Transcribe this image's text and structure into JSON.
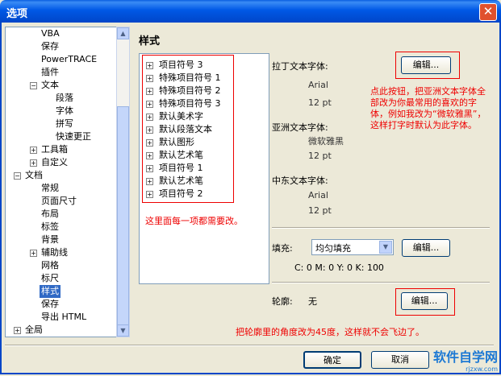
{
  "window": {
    "title": "选项",
    "close_glyph": "✕"
  },
  "tree": {
    "expand": "+",
    "collapse": "−",
    "items": [
      {
        "label": "VBA"
      },
      {
        "label": "保存"
      },
      {
        "label": "PowerTRACE"
      },
      {
        "label": "插件"
      },
      {
        "label": "文本"
      },
      {
        "label": "段落"
      },
      {
        "label": "字体"
      },
      {
        "label": "拼写"
      },
      {
        "label": "快速更正"
      },
      {
        "label": "工具箱"
      },
      {
        "label": "自定义"
      },
      {
        "label": "文档"
      },
      {
        "label": "常规"
      },
      {
        "label": "页面尺寸"
      },
      {
        "label": "布局"
      },
      {
        "label": "标签"
      },
      {
        "label": "背景"
      },
      {
        "label": "辅助线"
      },
      {
        "label": "网格"
      },
      {
        "label": "标尺"
      },
      {
        "label": "样式"
      },
      {
        "label": "保存"
      },
      {
        "label": "导出 HTML"
      },
      {
        "label": "全局"
      }
    ]
  },
  "panel": {
    "heading": "样式",
    "style_list": [
      "项目符号 3",
      "特殊项目符号 1",
      "特殊项目符号 2",
      "特殊项目符号 3",
      "默认美术字",
      "默认段落文本",
      "默认图形",
      "默认艺术笔",
      "项目符号 1",
      "默认艺术笔",
      "项目符号 2"
    ],
    "latin_label": "拉丁文本字体:",
    "latin_font": "Arial",
    "latin_size": "12 pt",
    "asian_label": "亚洲文本字体:",
    "asian_font": "微软雅黑",
    "asian_size": "12 pt",
    "me_label": "中东文本字体:",
    "me_font": "Arial",
    "me_size": "12 pt",
    "edit_label": "编辑...",
    "fill_label": "填充:",
    "fill_value": "均匀填充",
    "fill_color": "C: 0 M: 0 Y: 0 K: 100",
    "outline_label": "轮廓:",
    "outline_value": "无"
  },
  "annotations": {
    "edit_tip": "点此按钮，把亚洲文本字体全部改为你最常用的喜欢的字体，例如我改为“微软雅黑”，这样打字时默认为此字体。",
    "list_tip": "这里面每一项都需要改。",
    "outline_tip": "把轮廓里的角度改为45度，这样就不会飞边了。"
  },
  "footer": {
    "ok": "确定",
    "cancel": "取消"
  },
  "watermark": {
    "text": "软件自学网",
    "url": "rjzxw.com"
  },
  "colors": {
    "titlebar": "#0058e6",
    "selected": "#316ac5",
    "annotation": "#e00000"
  }
}
